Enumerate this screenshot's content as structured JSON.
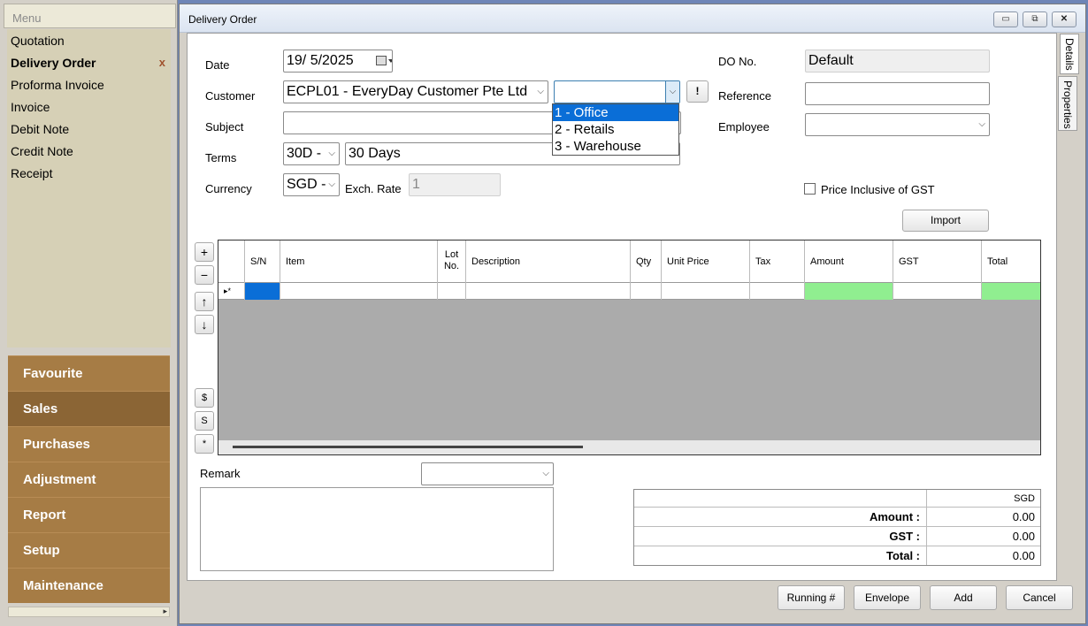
{
  "menu": {
    "title": "Menu",
    "items": [
      {
        "label": "Quotation"
      },
      {
        "label": "Delivery Order",
        "close": "x"
      },
      {
        "label": "Proforma Invoice"
      },
      {
        "label": "Invoice"
      },
      {
        "label": "Debit Note"
      },
      {
        "label": "Credit Note"
      },
      {
        "label": "Receipt"
      }
    ],
    "groups": [
      "Favourite",
      "Sales",
      "Purchases",
      "Adjustment",
      "Report",
      "Setup",
      "Maintenance"
    ],
    "active_group": "Sales",
    "scroll_arrow": "▸"
  },
  "window": {
    "title": "Delivery Order",
    "controls": {
      "minimize": "▭",
      "restore": "⧉",
      "close": "✕"
    }
  },
  "tabs": {
    "details": "Details",
    "properties": "Properties"
  },
  "form": {
    "date_label": "Date",
    "date_value": "19/  5/2025",
    "customer_label": "Customer",
    "customer_value": "ECPL01 - EveryDay Customer Pte Ltd",
    "address_value": "",
    "alert_button": "!",
    "subject_label": "Subject",
    "subject_value": "",
    "terms_label": "Terms",
    "terms_code": "30D -",
    "terms_desc": "30 Days",
    "currency_label": "Currency",
    "currency_value": "SGD -",
    "exch_rate_label": "Exch. Rate",
    "exch_rate_value": "1",
    "do_no_label": "DO No.",
    "do_no_value": "Default",
    "reference_label": "Reference",
    "reference_value": "",
    "employee_label": "Employee",
    "employee_value": "",
    "price_inclusive_label": "Price Inclusive of GST",
    "import_button": "Import"
  },
  "address_dropdown": {
    "options": [
      "1 - Office",
      "2 - Retails",
      "3 - Warehouse"
    ],
    "selected_index": 0
  },
  "grid": {
    "columns": [
      "S/N",
      "Item",
      "Lot No.",
      "Description",
      "Qty",
      "Unit Price",
      "Tax",
      "Amount",
      "GST",
      "Total"
    ],
    "lot_no_line1": "Lot",
    "lot_no_line2": "No.",
    "new_row_marker": "▸*",
    "highlight_color": "#90ee90",
    "selected_color": "#0a6ed7"
  },
  "side_buttons": {
    "add": "+",
    "remove": "−",
    "up": "↑",
    "down": "↓",
    "dollar": "$",
    "s": "S",
    "star": "*"
  },
  "remark": {
    "label": "Remark",
    "value": ""
  },
  "totals": {
    "currency": "SGD",
    "amount_label": "Amount :",
    "amount_value": "0.00",
    "gst_label": "GST :",
    "gst_value": "0.00",
    "total_label": "Total :",
    "total_value": "0.00"
  },
  "footer": {
    "running_button": "Running #",
    "envelope_button": "Envelope",
    "add_button": "Add",
    "cancel_button": "Cancel"
  }
}
